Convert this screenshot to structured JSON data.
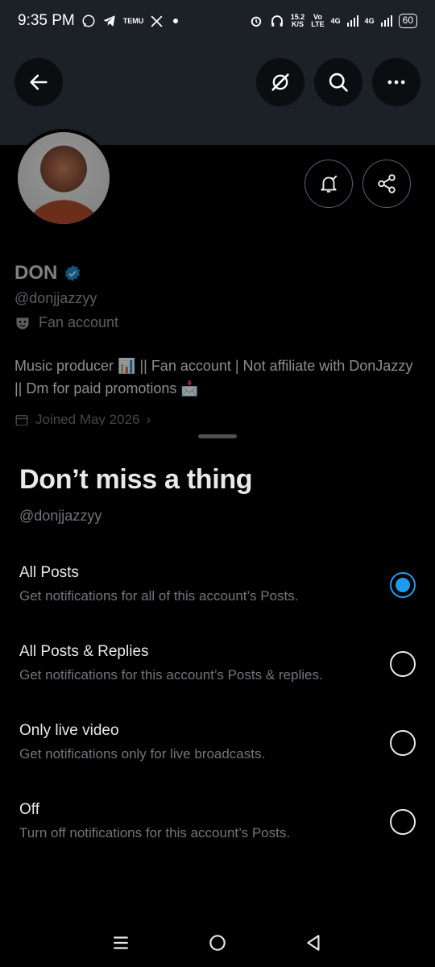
{
  "status_bar": {
    "time": "9:35 PM",
    "left_icons": [
      "whatsapp-icon",
      "telegram-icon",
      "temu-icon",
      "x-icon",
      "dot-icon"
    ],
    "temu_label": "TEMU",
    "speed_value": "15.2",
    "speed_unit": "K/S",
    "volte_top": "Vo",
    "volte_bottom": "LTE",
    "network_1": "4G",
    "network_2": "4G",
    "battery": "60"
  },
  "header": {
    "buttons": [
      "back-arrow-icon",
      "grok-icon",
      "search-icon",
      "more-icon"
    ]
  },
  "profile": {
    "name": "DON",
    "handle": "@donjjazzyy",
    "label": "Fan account",
    "bio_line1": "Music producer 📊 || Fan account | Not affiliate with DonJazzy",
    "bio_line2": "|| Dm for paid promotions 📩",
    "joined": "Joined May 2026",
    "verified_color": "#1d9bf0"
  },
  "sheet": {
    "title": "Don’t miss a thing",
    "handle": "@donjjazzyy",
    "options": [
      {
        "title": "All Posts",
        "desc": "Get notifications for all of this account’s Posts.",
        "selected": true
      },
      {
        "title": "All Posts & Replies",
        "desc": "Get notifications for this account’s Posts & replies.",
        "selected": false
      },
      {
        "title": "Only live video",
        "desc": "Get notifications only for live broadcasts.",
        "selected": false
      },
      {
        "title": "Off",
        "desc": "Turn off notifications for this account’s Posts.",
        "selected": false
      }
    ]
  },
  "colors": {
    "accent": "#1d9bf0",
    "secondary_text": "#71767b",
    "banner": "#1b2127"
  }
}
